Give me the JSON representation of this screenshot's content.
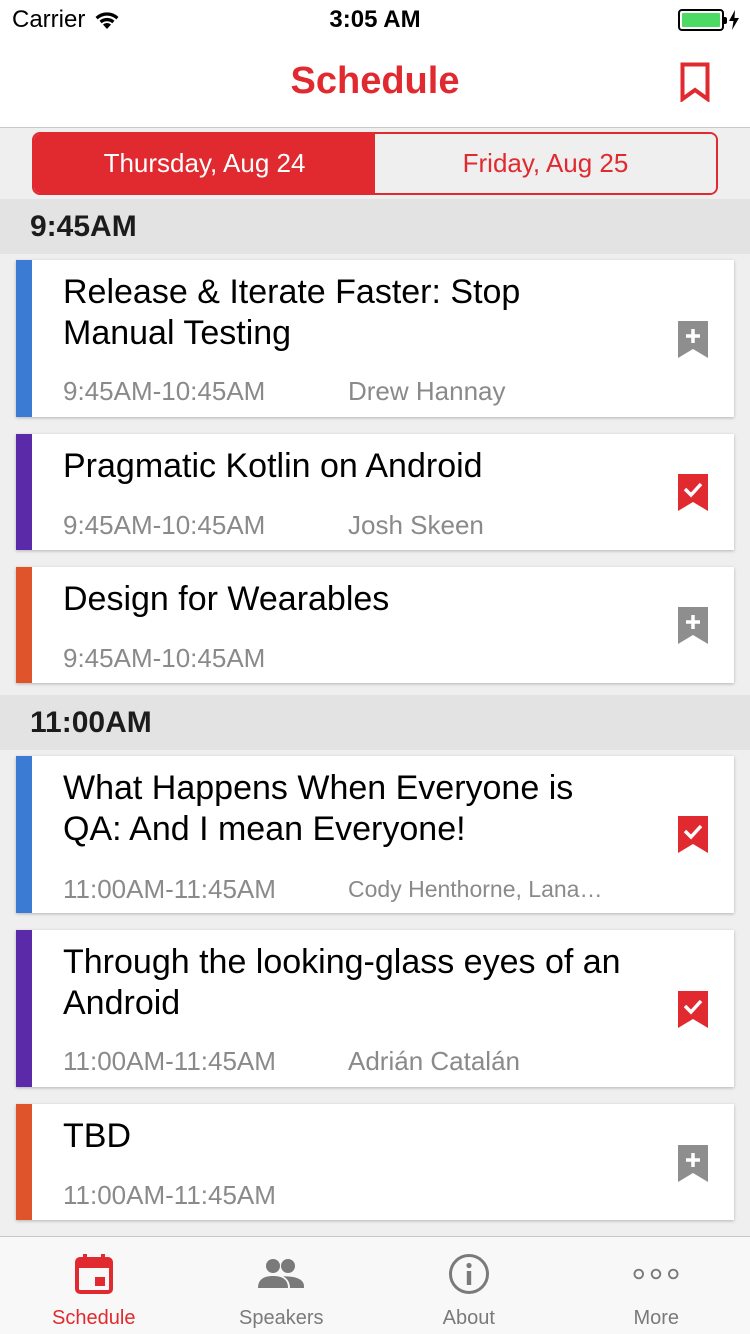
{
  "status_bar": {
    "carrier": "Carrier",
    "time": "3:05 AM",
    "battery_level": 1.0
  },
  "header": {
    "title": "Schedule",
    "bookmark_icon": "bookmark-outline-icon"
  },
  "day_tabs": [
    {
      "label": "Thursday, Aug 24",
      "selected": true
    },
    {
      "label": "Friday, Aug 25",
      "selected": false
    }
  ],
  "colors": {
    "accent": "#e12a2f",
    "track_blue": "#3b7bd3",
    "track_purple": "#5a2aa8",
    "track_orange": "#e0542c"
  },
  "schedule": [
    {
      "time": "9:45AM",
      "sessions": [
        {
          "title": "Release & Iterate Faster: Stop Manual Testing",
          "time_range": "9:45AM-10:45AM",
          "speaker": "Drew Hannay",
          "track_color": "#3b7bd3",
          "bookmarked": false
        },
        {
          "title": "Pragmatic Kotlin on Android",
          "time_range": "9:45AM-10:45AM",
          "speaker": "Josh Skeen",
          "track_color": "#5a2aa8",
          "bookmarked": true
        },
        {
          "title": "Design for Wearables",
          "time_range": "9:45AM-10:45AM",
          "speaker": "",
          "track_color": "#e0542c",
          "bookmarked": false
        }
      ]
    },
    {
      "time": "11:00AM",
      "sessions": [
        {
          "title": "What Happens When Everyone is QA: And I mean Everyone!",
          "time_range": "11:00AM-11:45AM",
          "speaker": "Cody Henthorne, Lana…",
          "track_color": "#3b7bd3",
          "bookmarked": true
        },
        {
          "title": "Through the looking-glass eyes of an Android",
          "time_range": "11:00AM-11:45AM",
          "speaker": "Adrián Catalán",
          "track_color": "#5a2aa8",
          "bookmarked": true
        },
        {
          "title": "TBD",
          "time_range": "11:00AM-11:45AM",
          "speaker": "",
          "track_color": "#e0542c",
          "bookmarked": false
        }
      ]
    }
  ],
  "tab_bar": [
    {
      "label": "Schedule",
      "icon": "calendar-icon",
      "active": true
    },
    {
      "label": "Speakers",
      "icon": "people-icon",
      "active": false
    },
    {
      "label": "About",
      "icon": "info-icon",
      "active": false
    },
    {
      "label": "More",
      "icon": "more-icon",
      "active": false
    }
  ]
}
